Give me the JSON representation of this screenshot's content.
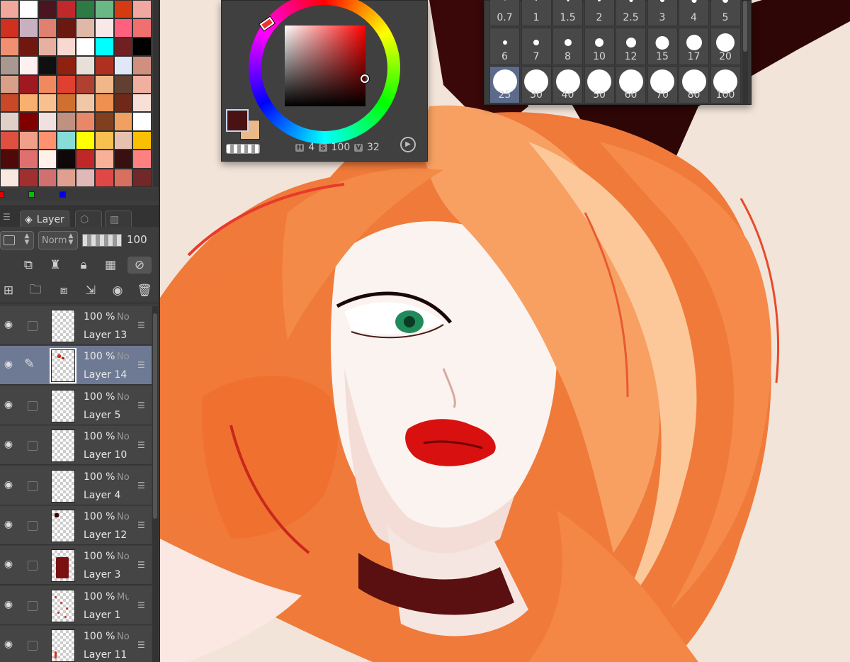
{
  "swatch_colors": [
    "#f0a89a",
    "#ffffff",
    "#4a1420",
    "#c0282c",
    "#2e7a44",
    "#6ab883",
    "#d63a10",
    "#f0a8a0",
    "#d03020",
    "#c8b0c0",
    "#e08070",
    "#6a1810",
    "#e0b8a8",
    "#f8e8e8",
    "#ff6080",
    "#f07070",
    "#f09070",
    "#701810",
    "#e8b0a0",
    "#f8d8d0",
    "#ffffff",
    "#00ffff",
    "#702020",
    "#000000",
    "#a89890",
    "#fff0f0",
    "#101010",
    "#902010",
    "#e8e0d8",
    "#b03020",
    "#e0e8f8",
    "#d09080",
    "#d8a088",
    "#a01820",
    "#f08860",
    "#e04030",
    "#b04030",
    "#f0b888",
    "#604030",
    "#f0b0a0",
    "#c84828",
    "#f8b070",
    "#f8c090",
    "#d07030",
    "#f0c8a8",
    "#f09050",
    "#702818",
    "#f8e0d8",
    "#e0d0c8",
    "#800000",
    "#f0e0e0",
    "#c09080",
    "#e88868",
    "#804020",
    "#f0a060",
    "#ffffff",
    "#e05040",
    "#f0a088",
    "#ff9070",
    "#88dcd8",
    "#ffff00",
    "#f8c050",
    "#e8c0b0",
    "#f8c000",
    "#500808",
    "#e07070",
    "#fff0e8",
    "#100808",
    "#c02828",
    "#f8b098",
    "#381010",
    "#ff8080",
    "#f8e8e0",
    "#a03030",
    "#d07070",
    "#e0a090",
    "#e0b8b8",
    "#e04848",
    "#d87060",
    "#702828"
  ],
  "rgb_indicators": [
    "#e00000",
    "#00c000",
    "#0000e0"
  ],
  "panel_tabs": {
    "layer_label": "Layer"
  },
  "layer_props": {
    "blend_mode": "Norm",
    "opacity": "100"
  },
  "layers": [
    {
      "opacity": "100 %",
      "blend": "No",
      "name": "Layer 13",
      "selected": false,
      "editing": false
    },
    {
      "opacity": "100 %",
      "blend": "No",
      "name": "Layer 14",
      "selected": true,
      "editing": true
    },
    {
      "opacity": "100 %",
      "blend": "No",
      "name": "Layer 5",
      "selected": false,
      "editing": false
    },
    {
      "opacity": "100 %",
      "blend": "No",
      "name": "Layer 10",
      "selected": false,
      "editing": false
    },
    {
      "opacity": "100 %",
      "blend": "No",
      "name": "Layer 4",
      "selected": false,
      "editing": false
    },
    {
      "opacity": "100 %",
      "blend": "No",
      "name": "Layer 12",
      "selected": false,
      "editing": false
    },
    {
      "opacity": "100 %",
      "blend": "No",
      "name": "Layer 3",
      "selected": false,
      "editing": false
    },
    {
      "opacity": "100 %",
      "blend": "Mu",
      "name": "Layer 1",
      "selected": false,
      "editing": false
    },
    {
      "opacity": "100 %",
      "blend": "No",
      "name": "Layer 11",
      "selected": false,
      "editing": false
    }
  ],
  "color_panel": {
    "main_color": "#4a1212",
    "sub_color": "#e9b98a",
    "h_key": "H",
    "h_value": "4",
    "s_key": "S",
    "s_value": "100",
    "v_key": "V",
    "v_value": "32"
  },
  "brush_sizes": {
    "labels": [
      "0.7",
      "1",
      "1.5",
      "2",
      "2.5",
      "3",
      "4",
      "5",
      "6",
      "7",
      "8",
      "10",
      "12",
      "15",
      "17",
      "20",
      "25",
      "30",
      "40",
      "50",
      "60",
      "70",
      "80",
      "100"
    ],
    "selected": "25"
  }
}
